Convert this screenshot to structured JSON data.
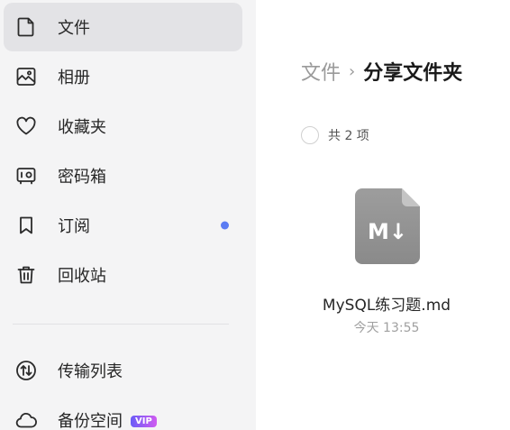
{
  "sidebar": {
    "items": [
      {
        "label": "文件",
        "icon": "file-icon",
        "active": true
      },
      {
        "label": "相册",
        "icon": "photo-album-icon"
      },
      {
        "label": "收藏夹",
        "icon": "heart-icon"
      },
      {
        "label": "密码箱",
        "icon": "safe-box-icon"
      },
      {
        "label": "订阅",
        "icon": "bookmark-icon",
        "has_dot": true
      },
      {
        "label": "回收站",
        "icon": "trash-icon"
      },
      {
        "label": "传输列表",
        "icon": "transfer-icon"
      },
      {
        "label": "备份空间",
        "icon": "cloud-icon",
        "badge": "VIP"
      }
    ],
    "dot_color": "#5b7cf3"
  },
  "breadcrumb": {
    "parent": "文件",
    "separator": "›",
    "current": "分享文件夹"
  },
  "list": {
    "count_label": "共 2 项"
  },
  "files": [
    {
      "name": "MySQL练习题.md",
      "time": "今天 13:55",
      "icon": "markdown-file-icon",
      "icon_text": "M↓"
    }
  ]
}
